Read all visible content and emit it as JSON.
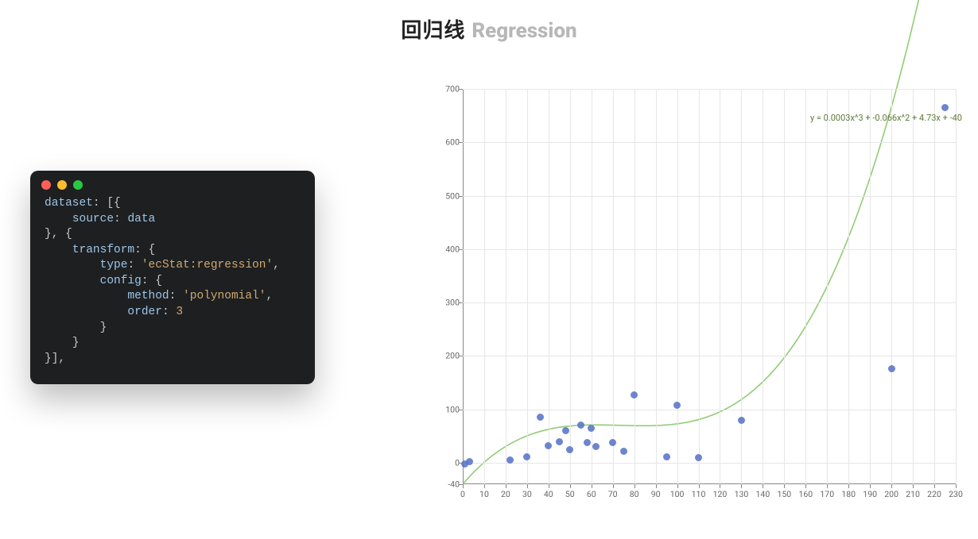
{
  "title": {
    "zh": "回归线",
    "en": "Regression"
  },
  "code": {
    "lines": [
      {
        "ind": 0,
        "parts": [
          {
            "t": "key",
            "v": "dataset"
          },
          {
            "t": "p",
            "v": ": [{"
          }
        ]
      },
      {
        "ind": 1,
        "parts": [
          {
            "t": "key",
            "v": "source"
          },
          {
            "t": "p",
            "v": ": "
          },
          {
            "t": "key",
            "v": "data"
          }
        ]
      },
      {
        "ind": 0,
        "parts": [
          {
            "t": "p",
            "v": "}, {"
          }
        ]
      },
      {
        "ind": 1,
        "parts": [
          {
            "t": "key",
            "v": "transform"
          },
          {
            "t": "p",
            "v": ": {"
          }
        ]
      },
      {
        "ind": 2,
        "parts": [
          {
            "t": "key",
            "v": "type"
          },
          {
            "t": "p",
            "v": ": "
          },
          {
            "t": "str",
            "v": "'ecStat:regression'"
          },
          {
            "t": "p",
            "v": ","
          }
        ]
      },
      {
        "ind": 2,
        "parts": [
          {
            "t": "key",
            "v": "config"
          },
          {
            "t": "p",
            "v": ": {"
          }
        ]
      },
      {
        "ind": 3,
        "parts": [
          {
            "t": "key",
            "v": "method"
          },
          {
            "t": "p",
            "v": ": "
          },
          {
            "t": "str",
            "v": "'polynomial'"
          },
          {
            "t": "p",
            "v": ","
          }
        ]
      },
      {
        "ind": 3,
        "parts": [
          {
            "t": "key",
            "v": "order"
          },
          {
            "t": "p",
            "v": ": "
          },
          {
            "t": "num",
            "v": "3"
          }
        ]
      },
      {
        "ind": 2,
        "parts": [
          {
            "t": "p",
            "v": "}"
          }
        ]
      },
      {
        "ind": 1,
        "parts": [
          {
            "t": "p",
            "v": "}"
          }
        ]
      },
      {
        "ind": 0,
        "parts": [
          {
            "t": "p",
            "v": "}],"
          }
        ]
      }
    ]
  },
  "chart_data": {
    "type": "scatter",
    "title": "",
    "xlabel": "",
    "ylabel": "",
    "xlim": [
      0,
      230
    ],
    "ylim": [
      -40,
      700
    ],
    "x_ticks": [
      0,
      10,
      20,
      30,
      40,
      50,
      60,
      70,
      80,
      90,
      100,
      110,
      120,
      130,
      140,
      150,
      160,
      170,
      180,
      190,
      200,
      210,
      220,
      230
    ],
    "y_ticks": [
      -40,
      0,
      100,
      200,
      300,
      400,
      500,
      600,
      700
    ],
    "grid": true,
    "equation_label": "y = 0.0003x^3 + -0.066x^2 + 4.73x + -40",
    "series": [
      {
        "name": "data",
        "kind": "scatter",
        "color": "#5470c6",
        "points": [
          [
            1,
            -2
          ],
          [
            3,
            2
          ],
          [
            22,
            5
          ],
          [
            30,
            12
          ],
          [
            36,
            85
          ],
          [
            40,
            32
          ],
          [
            45,
            40
          ],
          [
            48,
            60
          ],
          [
            50,
            25
          ],
          [
            55,
            70
          ],
          [
            58,
            38
          ],
          [
            60,
            65
          ],
          [
            62,
            30
          ],
          [
            70,
            38
          ],
          [
            75,
            22
          ],
          [
            80,
            127
          ],
          [
            95,
            12
          ],
          [
            100,
            108
          ],
          [
            110,
            10
          ],
          [
            130,
            80
          ],
          [
            200,
            176
          ],
          [
            225,
            665
          ]
        ]
      },
      {
        "name": "regression",
        "kind": "line",
        "color": "#91cc75",
        "coeffs": {
          "a3": 0.0003,
          "a2": -0.066,
          "a1": 4.73,
          "a0": -40
        }
      }
    ]
  }
}
